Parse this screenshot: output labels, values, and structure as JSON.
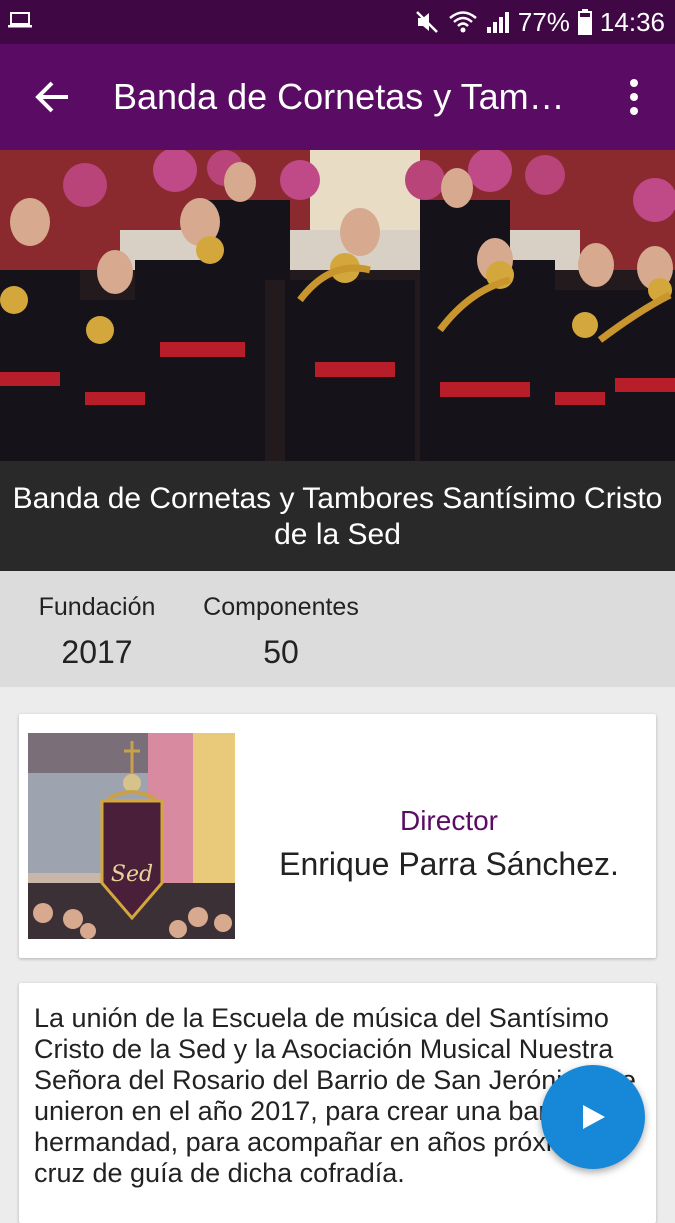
{
  "status_bar": {
    "battery": "77%",
    "time": "14:36",
    "icons": [
      "laptop-icon",
      "mute-icon",
      "wifi-icon",
      "signal-icon",
      "battery-icon"
    ]
  },
  "app_bar": {
    "title": "Banda de Cornetas y Tambores Santísimo Cristo de la Sed",
    "icons": [
      "back-arrow-icon",
      "more-vert-icon"
    ]
  },
  "header": {
    "caption": "Banda de Cornetas y Tambores Santísimo Cristo de la Sed"
  },
  "stats": [
    {
      "label": "Fundación",
      "value": "2017"
    },
    {
      "label": "Componentes",
      "value": "50"
    }
  ],
  "director_card": {
    "role": "Director",
    "name": "Enrique Parra Sánchez."
  },
  "description": {
    "text": "La unión de la Escuela de música del Santísimo Cristo de la Sed y la Asociación Musical Nuestra Señora del Rosario del Barrio de San Jerónimo se unieron en el año 2017, para crear una banda de hermandad, para acompañar en años próximos la cruz de guía de dicha cofradía."
  },
  "fab": {
    "icon": "play-icon"
  },
  "colors": {
    "status_bar": "#3f0845",
    "app_bar": "#5a0b64",
    "accent": "#5a0b64",
    "fab": "#1787d8",
    "caption_bg": "#292929"
  }
}
